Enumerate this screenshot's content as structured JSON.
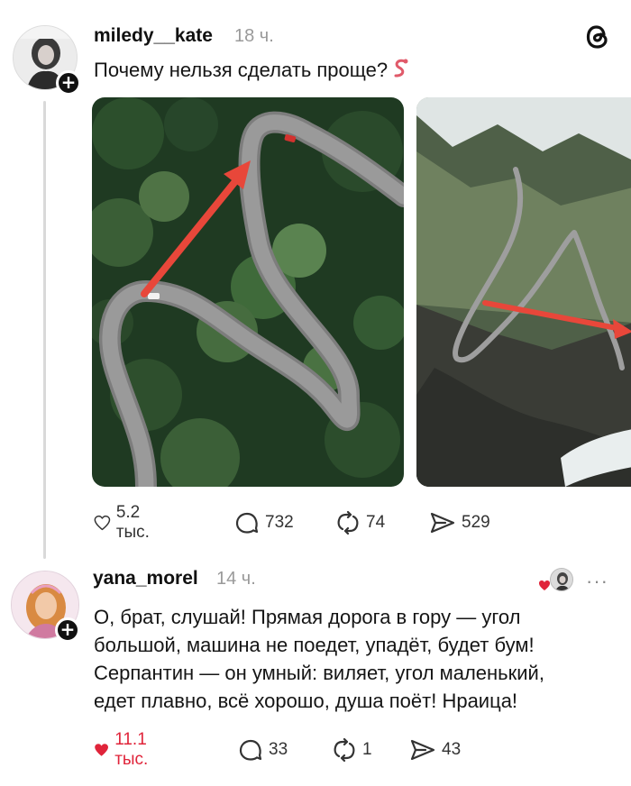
{
  "post1": {
    "username": "miledy__kate",
    "time": "18 ч.",
    "text": "Почему нельзя сделать проще?",
    "emoji": "snake-emoji",
    "images": [
      {
        "description_icon": "forest-serpentine-road-photo"
      },
      {
        "description_icon": "mountain-serpentine-road-photo"
      }
    ],
    "actions": {
      "likes": "5.2 тыс.",
      "comments": "732",
      "reposts": "74",
      "shares": "529"
    }
  },
  "post2": {
    "username": "yana_morel",
    "time": "14 ч.",
    "text_lines": [
      "О, брат, слушай! Прямая дорога в гору — угол",
      "большой, машина не поедет, упадёт, будет бум!",
      "Серпантин — он умный: виляет, угол маленький,",
      "едет плавно, всё хорошо, душа поёт! Нраица!"
    ],
    "more": "···",
    "actions": {
      "likes": "11.1 тыс.",
      "comments": "33",
      "reposts": "1",
      "shares": "43"
    }
  },
  "colors": {
    "accent_like": "#e0243a",
    "arrow_red": "#e8473a",
    "text_muted": "#9a9a9a"
  }
}
